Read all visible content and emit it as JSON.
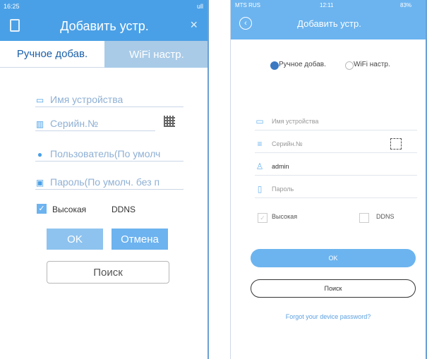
{
  "left": {
    "status": {
      "time": "16:25",
      "right": "ull"
    },
    "title": "Добавить устр.",
    "tabs": [
      {
        "label": "Ручное добав.",
        "active": true
      },
      {
        "label": "WiFi настр.",
        "active": false
      }
    ],
    "fields": {
      "device_name": "Имя устройства",
      "serial": "Серийн.№",
      "user": "Пользователь(По умолч",
      "password": "Пароль(По умолч. без п"
    },
    "checkbox": {
      "high": "Высокая",
      "ddns": "DDNS"
    },
    "buttons": {
      "ok": "OK",
      "cancel": "Отмена",
      "search": "Поиск"
    }
  },
  "right": {
    "status": {
      "carrier": "MTS RUS",
      "time": "12:11",
      "battery": "83%"
    },
    "title": "Добавить устр.",
    "radios": [
      {
        "label": "Ручное добав.",
        "selected": true
      },
      {
        "label": "WiFi настр.",
        "selected": false
      }
    ],
    "fields": {
      "device_name": "Имя устройства",
      "serial": "Серийн.№",
      "user": "admin",
      "password": "Пароль"
    },
    "checkbox": {
      "high": "Высокая",
      "ddns": "DDNS"
    },
    "buttons": {
      "ok": "OK",
      "search": "Поиск"
    },
    "forgot": "Forgot your device password?"
  },
  "colors": {
    "accent": "#4aa0e6",
    "accent_light": "#6cb4ef",
    "link": "#5a9fe0"
  }
}
